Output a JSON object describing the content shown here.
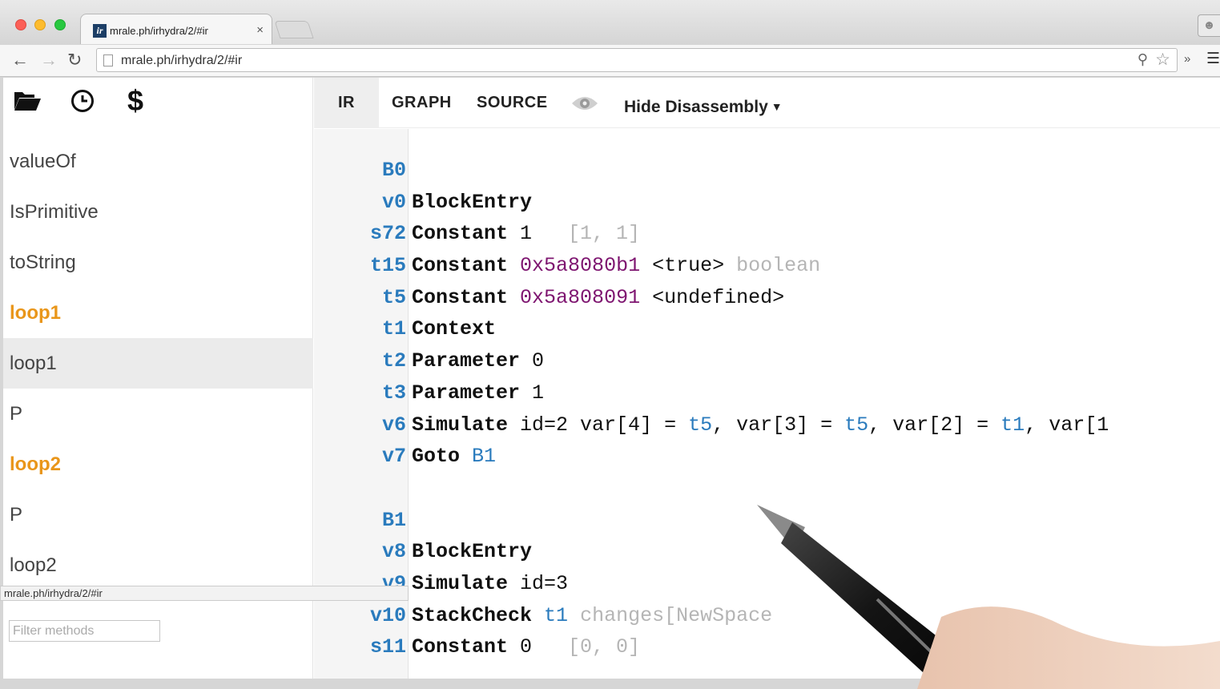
{
  "browser": {
    "tab_title": "mrale.ph/irhydra/2/#ir",
    "tab_close": "×",
    "favicon_text": "ir",
    "url": "mrale.ph/irhydra/2/#ir",
    "status_url": "mrale.ph/irhydra/2/#ir",
    "icons": [
      "back-arrow-icon",
      "forward-arrow-icon",
      "reload-icon",
      "page-icon",
      "zoom-icon",
      "star-icon",
      "chevrons-icon",
      "menu-icon",
      "profile-icon"
    ]
  },
  "sidebar": {
    "icons": [
      "folder-open-icon",
      "clock-icon",
      "dollar-icon"
    ],
    "dollar_glyph": "$",
    "methods": [
      {
        "label": "valueOf",
        "style": "normal"
      },
      {
        "label": "IsPrimitive",
        "style": "normal"
      },
      {
        "label": "toString",
        "style": "normal"
      },
      {
        "label": "loop1",
        "style": "hot"
      },
      {
        "label": "loop1",
        "style": "selected"
      },
      {
        "label": "P",
        "style": "normal"
      },
      {
        "label": "loop2",
        "style": "hot"
      },
      {
        "label": "P",
        "style": "normal"
      },
      {
        "label": "loop2",
        "style": "normal"
      }
    ],
    "filter_placeholder": "Filter methods"
  },
  "tabs": {
    "ir": "IR",
    "graph": "GRAPH",
    "source": "SOURCE",
    "disassembly": "Hide Disassembly",
    "active": "IR"
  },
  "code": {
    "blocks": [
      {
        "label": "B0",
        "lines": [
          {
            "id": "v0",
            "parts": [
              [
                "op",
                "BlockEntry"
              ]
            ]
          },
          {
            "id": "s72",
            "parts": [
              [
                "op",
                "Constant"
              ],
              [
                "txt",
                " 1  "
              ],
              [
                "faint",
                " [1, 1]"
              ]
            ]
          },
          {
            "id": "t15",
            "parts": [
              [
                "op",
                "Constant"
              ],
              [
                "txt",
                " "
              ],
              [
                "const",
                "0x5a8080b1"
              ],
              [
                "txt",
                " <true> "
              ],
              [
                "faint",
                "boolean"
              ]
            ]
          },
          {
            "id": "t5",
            "parts": [
              [
                "op",
                "Constant"
              ],
              [
                "txt",
                " "
              ],
              [
                "const",
                "0x5a808091"
              ],
              [
                "txt",
                " <undefined>"
              ]
            ]
          },
          {
            "id": "t1",
            "parts": [
              [
                "op",
                "Context"
              ]
            ]
          },
          {
            "id": "t2",
            "parts": [
              [
                "op",
                "Parameter"
              ],
              [
                "txt",
                " 0"
              ]
            ]
          },
          {
            "id": "t3",
            "parts": [
              [
                "op",
                "Parameter"
              ],
              [
                "txt",
                " 1"
              ]
            ]
          },
          {
            "id": "v6",
            "parts": [
              [
                "op",
                "Simulate"
              ],
              [
                "txt",
                " id=2 var[4] = "
              ],
              [
                "ref",
                "t5"
              ],
              [
                "txt",
                ", var[3] = "
              ],
              [
                "ref",
                "t5"
              ],
              [
                "txt",
                ", var[2] = "
              ],
              [
                "ref",
                "t1"
              ],
              [
                "txt",
                ", var[1"
              ]
            ]
          },
          {
            "id": "v7",
            "parts": [
              [
                "op",
                "Goto"
              ],
              [
                "txt",
                " "
              ],
              [
                "ref",
                "B1"
              ]
            ]
          }
        ]
      },
      {
        "label": "B1",
        "lines": [
          {
            "id": "v8",
            "parts": [
              [
                "op",
                "BlockEntry"
              ]
            ]
          },
          {
            "id": "v9",
            "parts": [
              [
                "op",
                "Simulate"
              ],
              [
                "txt",
                " id=3"
              ]
            ]
          },
          {
            "id": "v10",
            "parts": [
              [
                "op",
                "StackCheck"
              ],
              [
                "txt",
                " "
              ],
              [
                "ref",
                "t1"
              ],
              [
                "txt",
                " "
              ],
              [
                "faint",
                "changes[NewSpace"
              ]
            ]
          },
          {
            "id": "s11",
            "parts": [
              [
                "op",
                "Constant"
              ],
              [
                "txt",
                " 0  "
              ],
              [
                "faint",
                " [0, 0]"
              ]
            ]
          }
        ]
      }
    ]
  },
  "colors": {
    "hot_method": "#e9961a",
    "ref_blue": "#2a7bbd",
    "constant_purple": "#7e1570",
    "faint_gray": "#b5b5b5"
  }
}
